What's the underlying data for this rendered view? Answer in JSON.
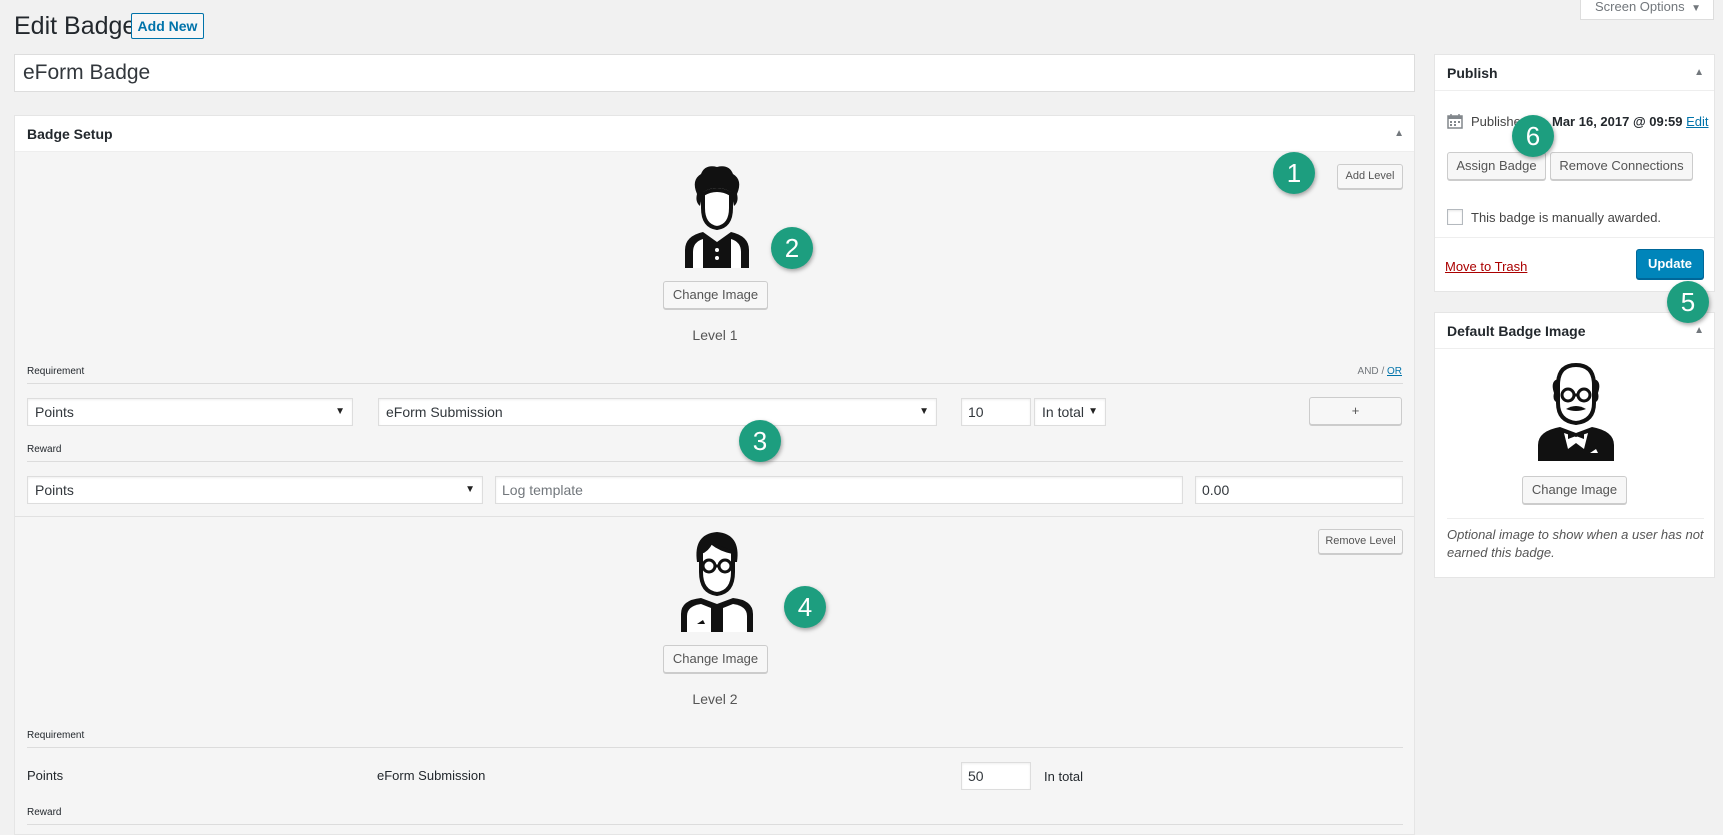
{
  "header": {
    "title": "Edit Badge",
    "add_new": "Add New",
    "screen_options": "Screen Options"
  },
  "post_title": "eForm Badge",
  "badge_setup": {
    "title": "Badge Setup",
    "add_level": "Add Level",
    "levels": [
      {
        "change_image": "Change Image",
        "label": "Level 1",
        "requirement_label": "Requirement",
        "and_text": "AND",
        "slash": "/",
        "or_text": "OR",
        "req_type": "Points",
        "req_event": "eForm Submission",
        "req_amount": "10",
        "req_scope": "In total",
        "plus_button": "+",
        "reward_label": "Reward",
        "reward_type": "Points",
        "log_placeholder": "Log template",
        "reward_amount": "0.00"
      },
      {
        "remove_level": "Remove Level",
        "change_image": "Change Image",
        "label": "Level 2",
        "requirement_label": "Requirement",
        "req_type": "Points",
        "req_event": "eForm Submission",
        "req_amount": "50",
        "req_scope": "In total",
        "reward_label": "Reward"
      }
    ]
  },
  "publish": {
    "title": "Publish",
    "published_label": "Publishe",
    "published_date": "Mar 16, 2017 @ 09:59",
    "edit_link": "Edit",
    "assign_badge": "Assign Badge",
    "remove_connections": "Remove Connections",
    "manual_label": "This badge is manually awarded.",
    "trash_link": "Move to Trash",
    "update": "Update"
  },
  "default_image": {
    "title": "Default Badge Image",
    "change_image": "Change Image",
    "note": "Optional image to show when a user has not earned this badge."
  },
  "callouts": [
    "1",
    "2",
    "3",
    "4",
    "5",
    "6"
  ],
  "colors": {
    "accent": "#0073aa",
    "primary_button": "#0085ba",
    "callout": "#1d9e7f",
    "trash": "#aa0000"
  }
}
